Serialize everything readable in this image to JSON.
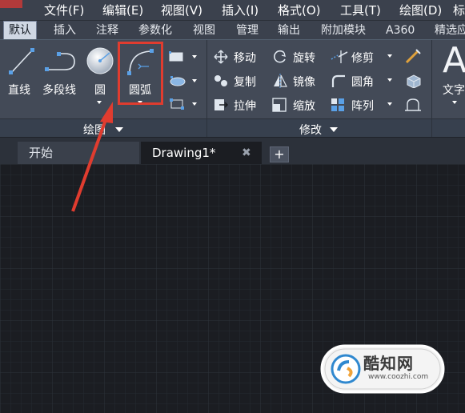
{
  "menubar": {
    "items": [
      "文件(F)",
      "编辑(E)",
      "视图(V)",
      "插入(I)",
      "格式(O)",
      "工具(T)",
      "绘图(D)",
      "标"
    ]
  },
  "ribbon_tabs": {
    "items": [
      "默认",
      "插入",
      "注释",
      "参数化",
      "视图",
      "管理",
      "输出",
      "附加模块",
      "A360",
      "精选应"
    ],
    "active": "默认"
  },
  "draw_panel": {
    "title": "绘图",
    "line_label": "直线",
    "polyline_label": "多段线",
    "circle_label": "圆",
    "arc_label": "圆弧"
  },
  "modify_panel": {
    "title": "修改",
    "move_label": "移动",
    "rotate_label": "旋转",
    "trim_label": "修剪",
    "copy_label": "复制",
    "mirror_label": "镜像",
    "fillet_label": "圆角",
    "stretch_label": "拉伸",
    "scale_label": "缩放",
    "array_label": "阵列"
  },
  "annotation_panel": {
    "text_label": "文字",
    "big_letter": "A"
  },
  "document_tabs": {
    "start_label": "开始",
    "drawing_label": "Drawing1*",
    "close_glyph": "✖",
    "new_tab_glyph": "+"
  },
  "watermark": {
    "text": "酷知网",
    "sub": "www.coozhi.com"
  },
  "colors": {
    "menubar": "#3b414d",
    "ribbon": "#434a57",
    "canvas": "#1b1d22",
    "highlight": "#e03c2f",
    "icon_blue": "#5aa0e6"
  }
}
